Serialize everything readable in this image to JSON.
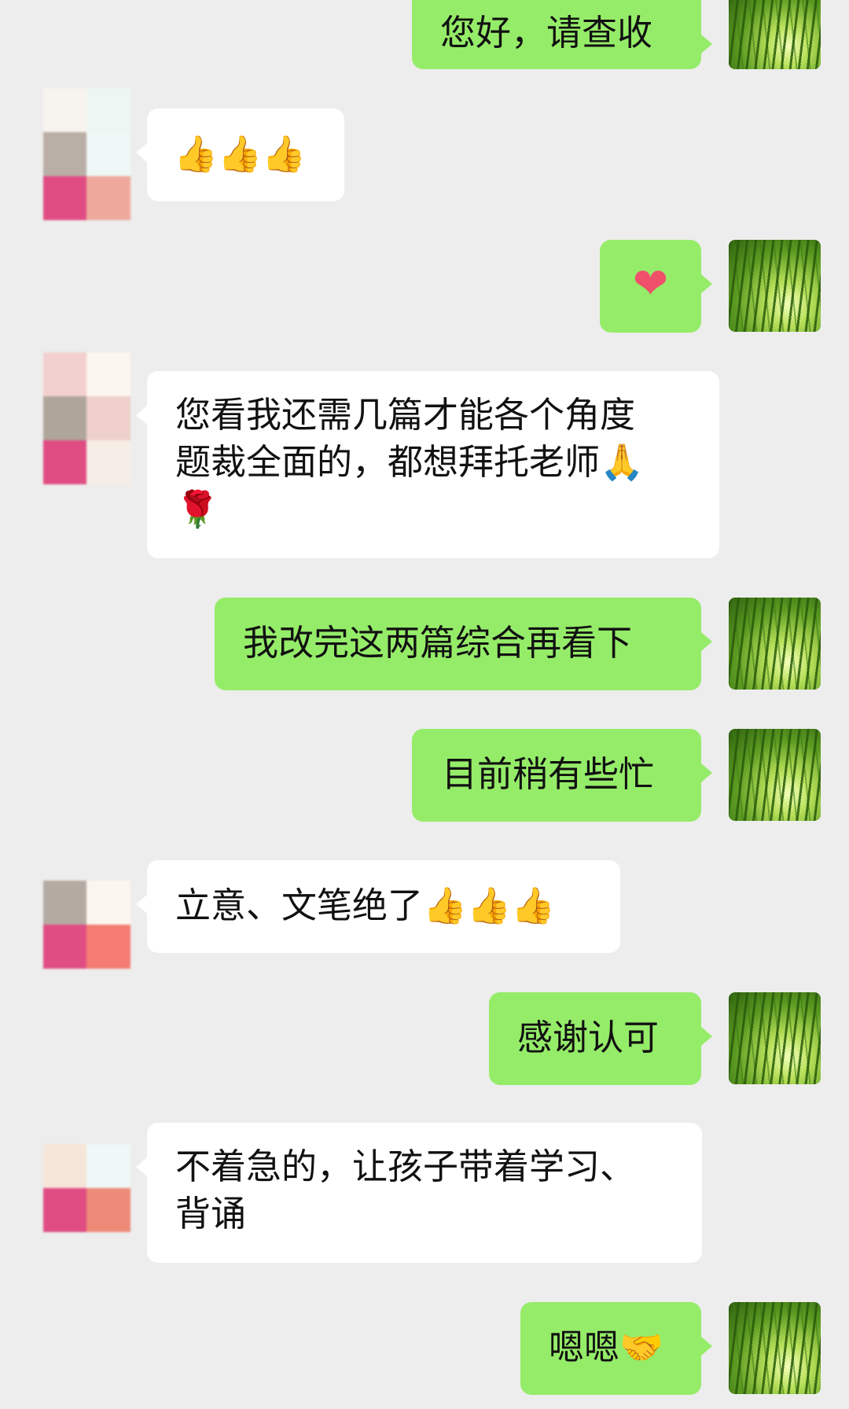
{
  "messages": [
    {
      "side": "right",
      "text": "您好，请查收"
    },
    {
      "side": "left",
      "text": "👍👍👍"
    },
    {
      "side": "right",
      "text": "❤"
    },
    {
      "side": "left",
      "text": "您看我还需几篇才能各个角度\n题裁全面的，都想拜托老师🙏\n🌹"
    },
    {
      "side": "right",
      "text": "我改完这两篇综合再看下"
    },
    {
      "side": "right",
      "text": "目前稍有些忙"
    },
    {
      "side": "left",
      "text": "立意、文笔绝了👍👍👍"
    },
    {
      "side": "right",
      "text": "感谢认可"
    },
    {
      "side": "left",
      "text": "不着急的，让孩子带着学习、\n背诵"
    },
    {
      "side": "right",
      "text": "嗯嗯🤝"
    }
  ],
  "colors": {
    "background": "#EDEDED",
    "bubble_left": "#FFFFFF",
    "bubble_right": "#95EC69"
  }
}
